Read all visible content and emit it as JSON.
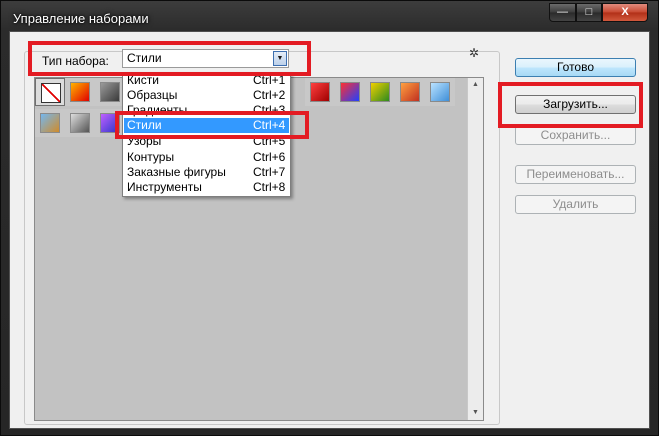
{
  "window": {
    "title": "Управление наборами"
  },
  "caption_buttons": {
    "minimize": "—",
    "maximize": "□",
    "close": "X"
  },
  "set_type": {
    "label": "Тип набора:",
    "value": "Стили"
  },
  "dropdown": {
    "items": [
      {
        "name": "Кисти",
        "shortcut": "Ctrl+1"
      },
      {
        "name": "Образцы",
        "shortcut": "Ctrl+2"
      },
      {
        "name": "Градиенты",
        "shortcut": "Ctrl+3"
      },
      {
        "name": "Стили",
        "shortcut": "Ctrl+4",
        "selected": true
      },
      {
        "name": "Узоры",
        "shortcut": "Ctrl+5"
      },
      {
        "name": "Контуры",
        "shortcut": "Ctrl+6"
      },
      {
        "name": "Заказные фигуры",
        "shortcut": "Ctrl+7"
      },
      {
        "name": "Инструменты",
        "shortcut": "Ctrl+8"
      }
    ]
  },
  "buttons": {
    "done": "Готово",
    "load": "Загрузить...",
    "save": "Сохранить...",
    "rename": "Переименовать...",
    "delete": "Удалить"
  },
  "highlight_color": "#e31b23",
  "selection_color": "#3399ff",
  "style_swatches": [
    {
      "name": "no-style",
      "colors": [
        "#ffffff",
        "#ffffff"
      ]
    },
    {
      "name": "red-glow",
      "colors": [
        "#ffb300",
        "#e00000"
      ]
    },
    {
      "name": "gray-inset",
      "colors": [
        "#9a9a9a",
        "#3a3a3a"
      ]
    },
    {
      "name": "wood",
      "colors": [
        "#caa060",
        "#7a4a18"
      ]
    },
    {
      "name": "red-stripes",
      "colors": [
        "#ff4040",
        "#a00000"
      ]
    },
    {
      "name": "rainbow-square",
      "colors": [
        "#ff3030",
        "#2040ff"
      ]
    },
    {
      "name": "gold-frame",
      "colors": [
        "#f0d000",
        "#2d8a1e"
      ]
    },
    {
      "name": "sunset",
      "colors": [
        "#ffa040",
        "#c03020"
      ]
    },
    {
      "name": "sky-blue",
      "colors": [
        "#b9e2ff",
        "#3f8fd8"
      ]
    },
    {
      "name": "landscape",
      "colors": [
        "#74b7ef",
        "#d08b2a"
      ]
    },
    {
      "name": "pixel-noise",
      "colors": [
        "#dddddd",
        "#555555"
      ]
    },
    {
      "name": "violet-glass",
      "colors": [
        "#c060ff",
        "#2a36c8"
      ]
    }
  ]
}
